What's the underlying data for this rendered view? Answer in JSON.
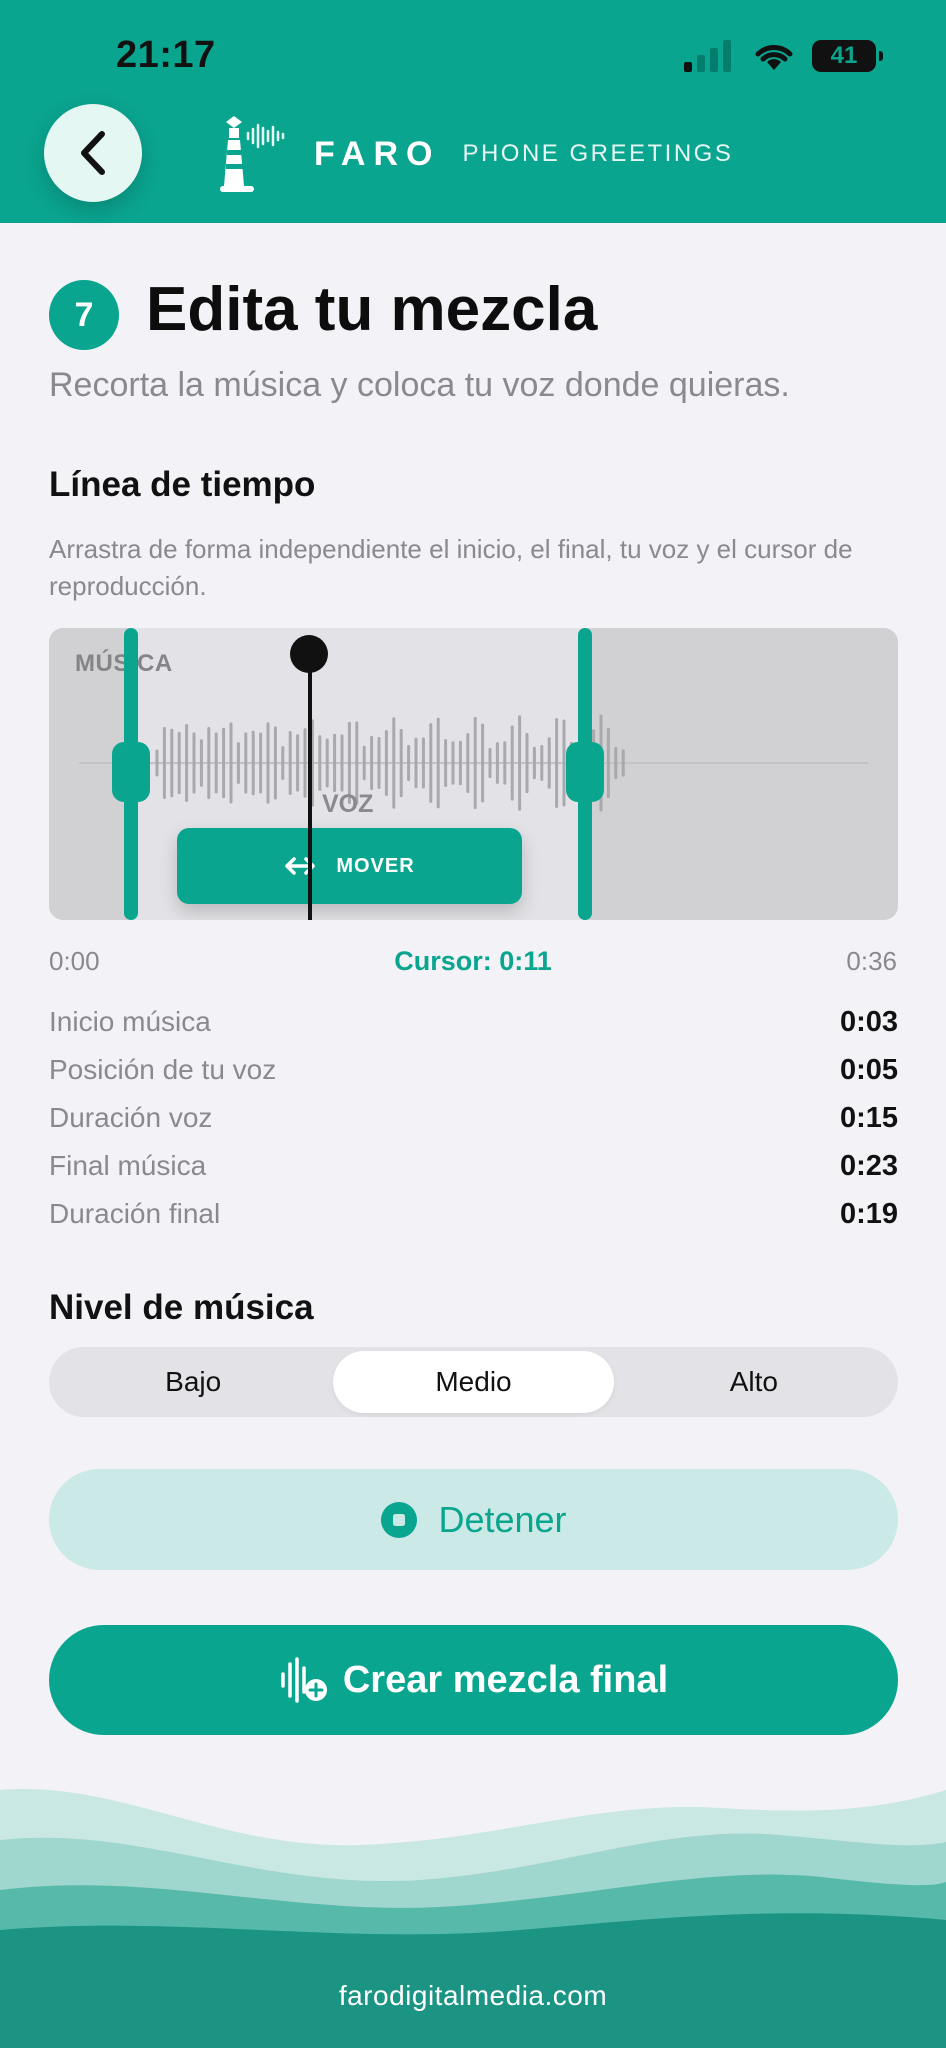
{
  "status_bar": {
    "time": "21:17",
    "battery": "41",
    "icons": [
      "signal-icon",
      "wifi-icon",
      "battery-icon"
    ]
  },
  "header": {
    "back_icon": "chevron-left-icon",
    "logo_icon": "lighthouse-icon",
    "brand_name": "FARO",
    "brand_tagline": "PHONE GREETINGS"
  },
  "page": {
    "step_number": "7",
    "title": "Edita tu mezcla",
    "subtitle": "Recorta la música y coloca tu voz donde quieras."
  },
  "timeline": {
    "title": "Línea de tiempo",
    "help": "Arrastra de forma independiente el inicio, el final, tu voz y el cursor de reproducción.",
    "music_label": "MÚSICA",
    "voice_label": "VOZ",
    "move_label": "MOVER",
    "move_icon": "arrows-horizontal-icon",
    "scale_start": "0:00",
    "cursor": "Cursor: 0:11",
    "scale_end": "0:36"
  },
  "stats": [
    {
      "label": "Inicio música",
      "value": "0:03"
    },
    {
      "label": "Posición de tu voz",
      "value": "0:05"
    },
    {
      "label": "Duración voz",
      "value": "0:15"
    },
    {
      "label": "Final música",
      "value": "0:23"
    },
    {
      "label": "Duración final",
      "value": "0:19"
    }
  ],
  "music_level": {
    "title": "Nivel de música",
    "options": [
      "Bajo",
      "Medio",
      "Alto"
    ],
    "selected": "Medio"
  },
  "actions": {
    "stop_label": "Detener",
    "stop_icon": "stop-circle-icon",
    "create_label": "Crear mezcla final",
    "create_icon": "waveform-plus-icon"
  },
  "footer": {
    "link": "farodigitalmedia.com"
  },
  "colors": {
    "accent": "#0aa58f",
    "accent_light": "#cbe9e6",
    "background": "#f2f2f7",
    "muted_text": "#8a8a8e"
  }
}
